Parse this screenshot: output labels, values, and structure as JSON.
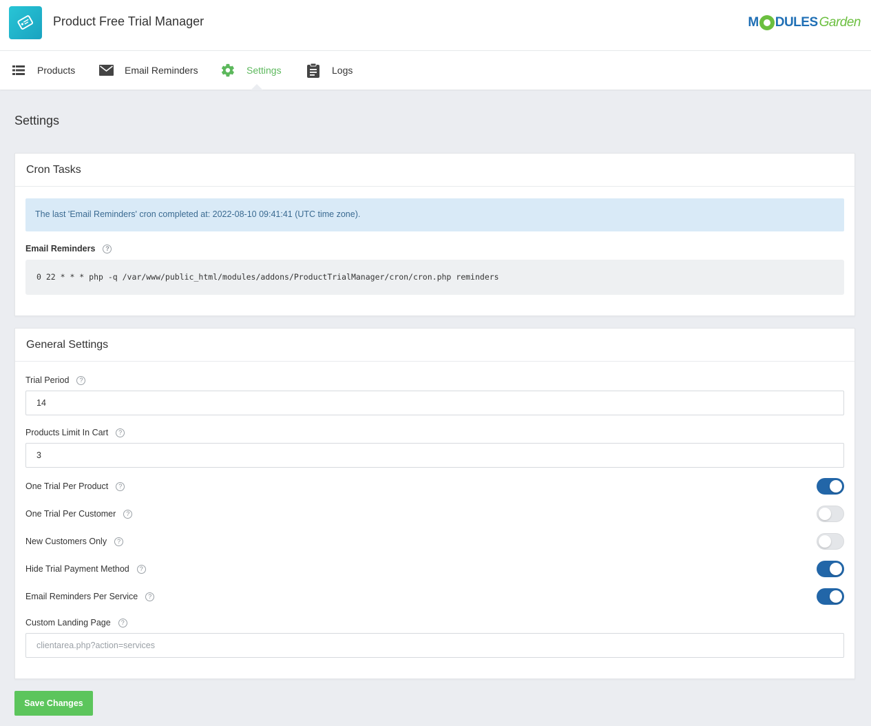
{
  "app": {
    "title": "Product Free Trial Manager",
    "brand": {
      "part1": "M",
      "part2": "DULES",
      "part3": "Garden"
    }
  },
  "nav": {
    "items": [
      {
        "label": "Products",
        "icon": "list-icon"
      },
      {
        "label": "Email Reminders",
        "icon": "envelope-icon"
      },
      {
        "label": "Settings",
        "icon": "gear-icon",
        "active": true
      },
      {
        "label": "Logs",
        "icon": "clipboard-icon"
      }
    ]
  },
  "page": {
    "title": "Settings"
  },
  "cron": {
    "title": "Cron Tasks",
    "alert": "The last 'Email Reminders' cron completed at: 2022-08-10 09:41:41 (UTC time zone).",
    "label": "Email Reminders",
    "command": "0 22 * * * php -q /var/www/public_html/modules/addons/ProductTrialManager/cron/cron.php reminders"
  },
  "general": {
    "title": "General Settings",
    "trial_period": {
      "label": "Trial Period",
      "value": "14"
    },
    "products_limit": {
      "label": "Products Limit In Cart",
      "value": "3"
    },
    "toggles": [
      {
        "label": "One Trial Per Product",
        "on": true
      },
      {
        "label": "One Trial Per Customer",
        "on": false
      },
      {
        "label": "New Customers Only",
        "on": false
      },
      {
        "label": "Hide Trial Payment Method",
        "on": true
      },
      {
        "label": "Email Reminders Per Service",
        "on": true
      }
    ],
    "landing": {
      "label": "Custom Landing Page",
      "value": "",
      "placeholder": "clientarea.php?action=services"
    }
  },
  "actions": {
    "save_label": "Save Changes"
  },
  "colors": {
    "accent_green": "#5cb85c",
    "toggle_blue": "#2266a8",
    "alert_bg": "#d9eaf7"
  }
}
